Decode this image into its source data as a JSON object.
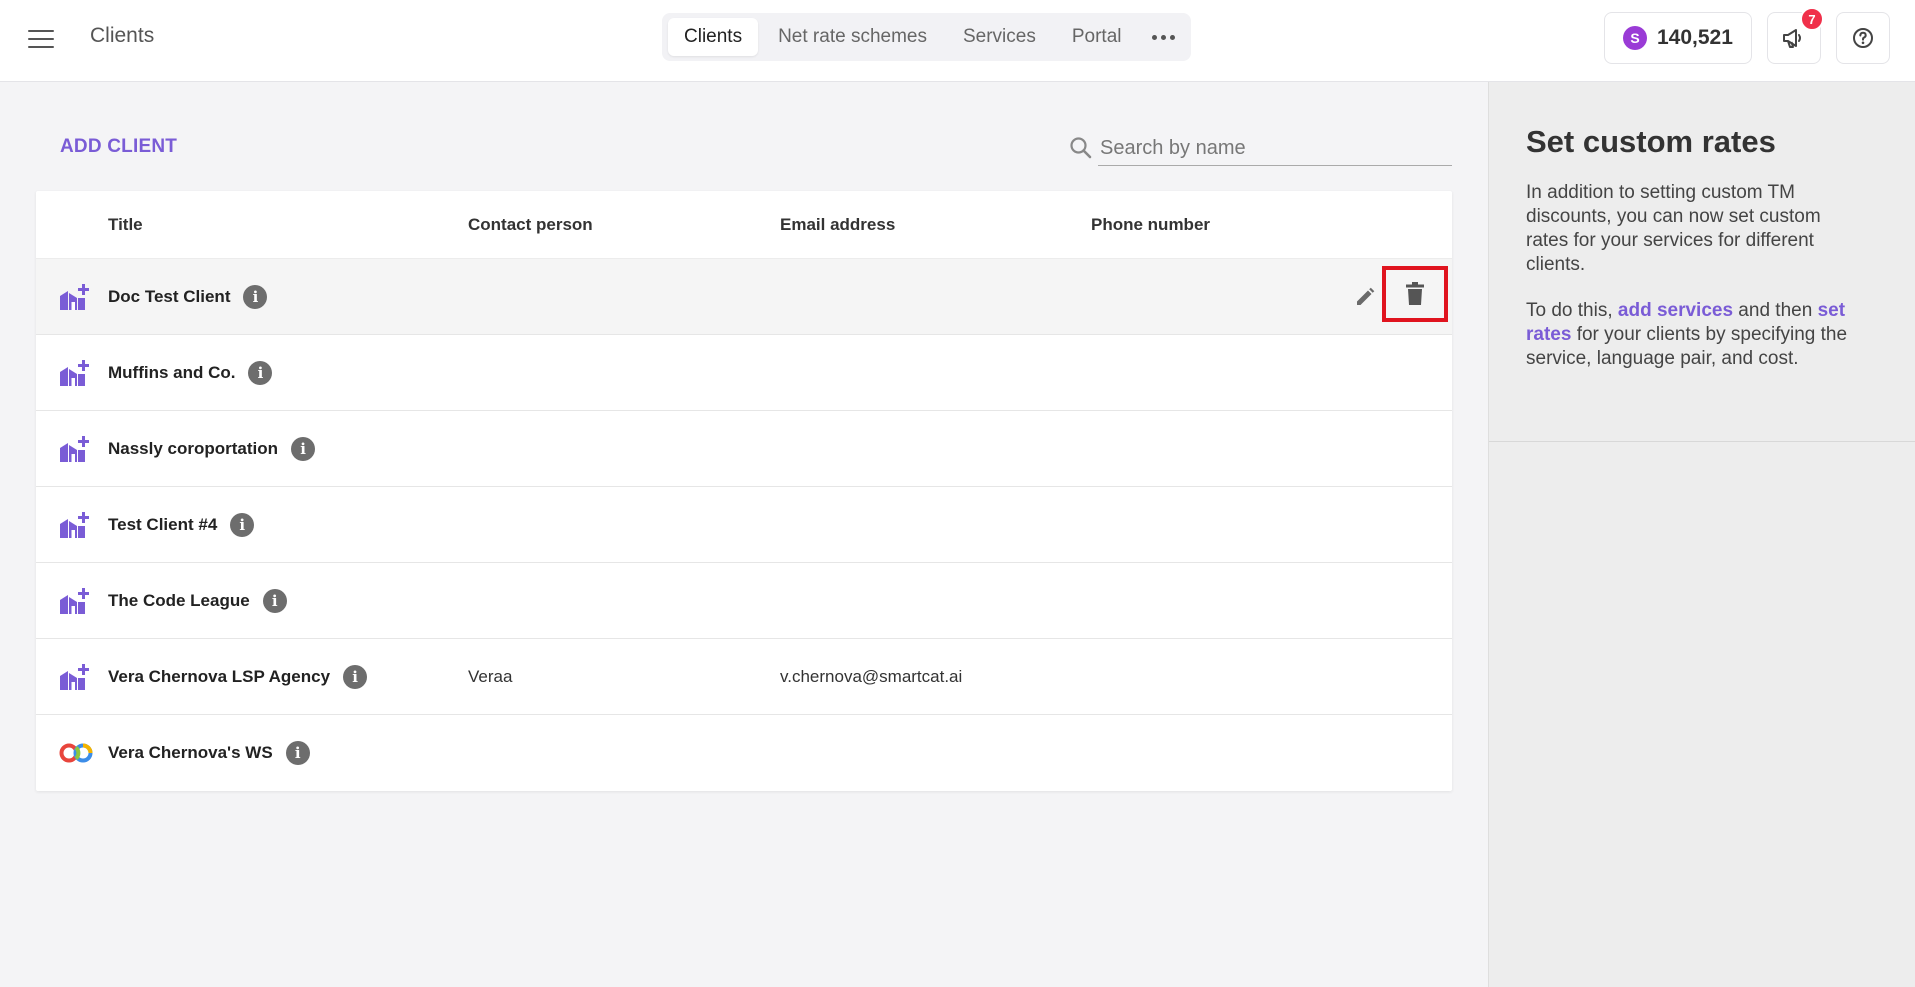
{
  "header": {
    "app_title": "Clients",
    "tabs": [
      {
        "label": "Clients",
        "active": true
      },
      {
        "label": "Net rate schemes",
        "active": false
      },
      {
        "label": "Services",
        "active": false
      },
      {
        "label": "Portal",
        "active": false
      }
    ],
    "balance": {
      "coin_letter": "S",
      "value": "140,521"
    },
    "notifications_count": "7"
  },
  "main": {
    "add_client_label": "ADD CLIENT",
    "search_placeholder": "Search by name",
    "columns": {
      "title": "Title",
      "contact": "Contact person",
      "email": "Email address",
      "phone": "Phone number"
    },
    "rows": [
      {
        "title": "Doc Test Client",
        "contact": "",
        "email": "",
        "phone": "",
        "icon": "client-company-icon"
      },
      {
        "title": "Muffins and Co.",
        "contact": "",
        "email": "",
        "phone": "",
        "icon": "client-company-icon"
      },
      {
        "title": "Nassly coroportation",
        "contact": "",
        "email": "",
        "phone": "",
        "icon": "client-company-icon"
      },
      {
        "title": "Test Client #4",
        "contact": "",
        "email": "",
        "phone": "",
        "icon": "client-company-icon"
      },
      {
        "title": "The Code League",
        "contact": "",
        "email": "",
        "phone": "",
        "icon": "client-company-icon"
      },
      {
        "title": "Vera Chernova LSP Agency",
        "contact": "Veraa",
        "email": "v.chernova@smartcat.ai",
        "phone": "",
        "icon": "client-company-icon"
      },
      {
        "title": "Vera Chernova's WS",
        "contact": "",
        "email": "",
        "phone": "",
        "icon": "workspace-rings-icon"
      }
    ]
  },
  "side_panel": {
    "heading": "Set custom rates",
    "paragraph1": "In addition to setting custom TM discounts, you can now set custom rates for your services for different clients.",
    "p2_before": "To do this, ",
    "p2_link1": "add services",
    "p2_middle": " and then ",
    "p2_link2": "set rates",
    "p2_after": " for your clients by specifying the service, language pair, and cost."
  },
  "colors": {
    "accent": "#7a5cd6",
    "highlight_box": "#e0141e",
    "badge": "#f0304a",
    "coin": "#9a3bd6"
  }
}
